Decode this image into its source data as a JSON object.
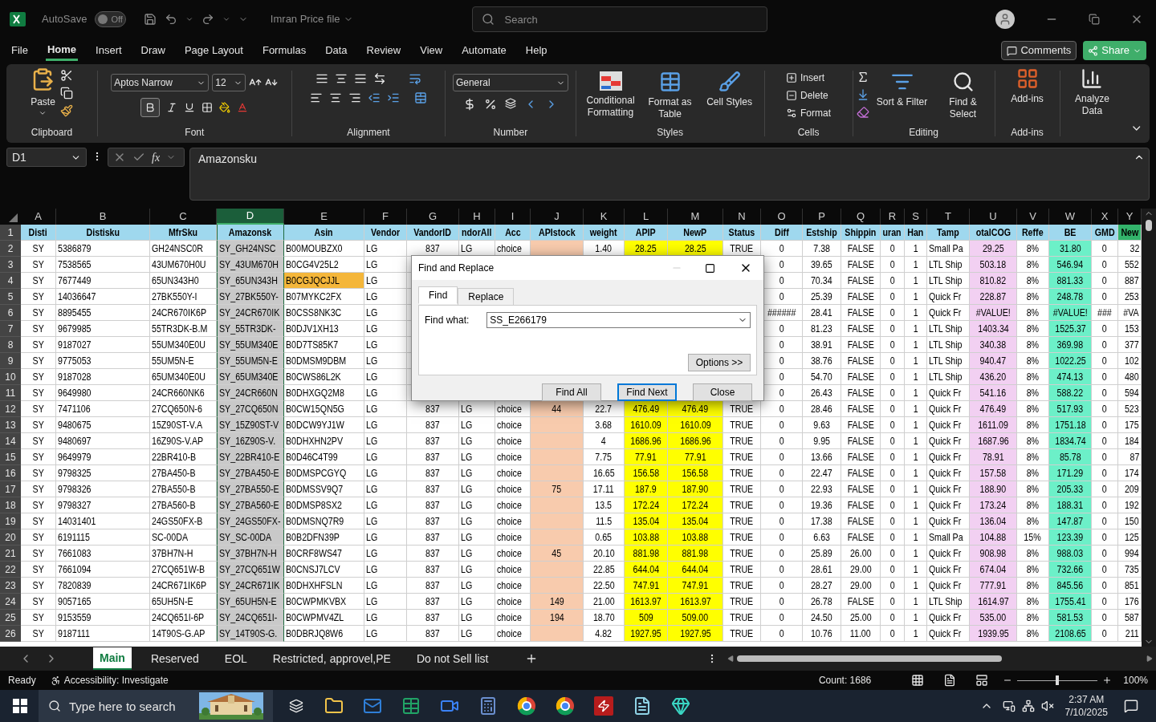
{
  "title_bar": {
    "autosave_label": "AutoSave",
    "autosave": {
      "on": false,
      "label": "Off"
    },
    "file_name": "Imran Price file",
    "search_placeholder": "Search"
  },
  "menu_tabs": [
    {
      "label": "File",
      "selected": false
    },
    {
      "label": "Home",
      "selected": true
    },
    {
      "label": "Insert",
      "selected": false
    },
    {
      "label": "Draw",
      "selected": false
    },
    {
      "label": "Page Layout",
      "selected": false
    },
    {
      "label": "Formulas",
      "selected": false
    },
    {
      "label": "Data",
      "selected": false
    },
    {
      "label": "Review",
      "selected": false
    },
    {
      "label": "View",
      "selected": false
    },
    {
      "label": "Automate",
      "selected": false
    },
    {
      "label": "Help",
      "selected": false
    }
  ],
  "comments_button": "Comments",
  "share_button": "Share",
  "ribbon": {
    "paste": "Paste",
    "font_name": "Aptos Narrow",
    "font_size": "12",
    "bold": true,
    "number_format": "General",
    "style_buttons": [
      "Conditional Formatting",
      "Format as Table",
      "Cell Styles"
    ],
    "cell_buttons": [
      "Insert",
      "Delete",
      "Format"
    ],
    "editing_buttons": [
      "Sort & Filter",
      "Find & Select"
    ],
    "addins_button": "Add-ins",
    "analyze_button": "Analyze Data",
    "groups": [
      "Clipboard",
      "Font",
      "Alignment",
      "Number",
      "Styles",
      "Cells",
      "Editing",
      "Add-ins"
    ]
  },
  "formula_bar": {
    "name_box": "D1",
    "function_label": "fx",
    "content": "Amazonsku"
  },
  "columns": [
    {
      "letter": "A",
      "heading": "Disti",
      "selected": false,
      "heading_fill": false
    },
    {
      "letter": "B",
      "heading": "Distisku",
      "selected": false,
      "heading_fill": false
    },
    {
      "letter": "C",
      "heading": "MfrSku",
      "selected": false,
      "heading_fill": false
    },
    {
      "letter": "D",
      "heading": "Amazonsk",
      "selected": true,
      "heading_fill": false
    },
    {
      "letter": "E",
      "heading": "Asin",
      "selected": false,
      "heading_fill": false
    },
    {
      "letter": "F",
      "heading": "Vendor",
      "selected": false,
      "heading_fill": false
    },
    {
      "letter": "G",
      "heading": "VandorID",
      "selected": false,
      "heading_fill": false
    },
    {
      "letter": "H",
      "heading": "ndorAll",
      "selected": false,
      "heading_fill": false
    },
    {
      "letter": "I",
      "heading": "Acc",
      "selected": false,
      "heading_fill": false
    },
    {
      "letter": "J",
      "heading": "APIstock",
      "selected": false,
      "heading_fill": false,
      "color": "#f8cbad"
    },
    {
      "letter": "K",
      "heading": "weight",
      "selected": false,
      "heading_fill": false
    },
    {
      "letter": "L",
      "heading": "APIP",
      "selected": false,
      "heading_fill": false,
      "color": "#ffff00"
    },
    {
      "letter": "M",
      "heading": "NewP",
      "selected": false,
      "heading_fill": false,
      "color": "#ffff00"
    },
    {
      "letter": "N",
      "heading": "Status",
      "selected": false,
      "heading_fill": false
    },
    {
      "letter": "O",
      "heading": "Diff",
      "selected": false,
      "heading_fill": false
    },
    {
      "letter": "P",
      "heading": "Estship",
      "selected": false,
      "heading_fill": false
    },
    {
      "letter": "Q",
      "heading": "Shippin",
      "selected": false,
      "heading_fill": false
    },
    {
      "letter": "R",
      "heading": "uran",
      "selected": false,
      "heading_fill": false
    },
    {
      "letter": "S",
      "heading": "Han",
      "selected": false,
      "heading_fill": false
    },
    {
      "letter": "T",
      "heading": "Tamp",
      "selected": false,
      "heading_fill": false
    },
    {
      "letter": "U",
      "heading": "otalCOG",
      "selected": false,
      "heading_fill": false,
      "color": "#f2d0f2"
    },
    {
      "letter": "V",
      "heading": "Reffe",
      "selected": false,
      "heading_fill": false
    },
    {
      "letter": "W",
      "heading": "BE",
      "selected": false,
      "heading_fill": false,
      "color": "#6cf0c8"
    },
    {
      "letter": "X",
      "heading": "GMD",
      "selected": false,
      "heading_fill": false
    },
    {
      "letter": "Y",
      "heading": "New",
      "selected": false,
      "heading_fill": true,
      "color": "#33b36b"
    }
  ],
  "rows": [
    {
      "number": "2",
      "flagged": false,
      "cells": [
        "SY",
        "5386879",
        "GH24NSC0R",
        "SY_GH24NSC",
        "B00MOUBZX0",
        "LG",
        "837",
        "LG",
        "choice",
        null,
        "1.40",
        "28.25",
        "28.25",
        "TRUE",
        "0",
        "7.38",
        "FALSE",
        "0",
        "1",
        "Small Pa",
        "29.25",
        "8%",
        "31.80",
        "0",
        "32"
      ]
    },
    {
      "number": "3",
      "flagged": false,
      "cells": [
        "SY",
        "7538565",
        "43UM670H0U",
        "SY_43UM670H",
        "B0CG4V25L2",
        "LG",
        null,
        null,
        null,
        null,
        null,
        null,
        null,
        null,
        "0",
        "39.65",
        "FALSE",
        "0",
        "1",
        "LTL Ship",
        "503.18",
        "8%",
        "546.94",
        "0",
        "552"
      ]
    },
    {
      "number": "4",
      "flagged": true,
      "cells": [
        "SY",
        "7677449",
        "65UN343H0",
        "SY_65UN343H",
        "B0CGJQCJJL",
        "LG",
        null,
        null,
        null,
        null,
        null,
        null,
        null,
        null,
        "0",
        "70.34",
        "FALSE",
        "0",
        "1",
        "LTL Ship",
        "810.82",
        "8%",
        "881.33",
        "0",
        "887"
      ]
    },
    {
      "number": "5",
      "flagged": false,
      "cells": [
        "SY",
        "14036647",
        "27BK550Y-I",
        "SY_27BK550Y-",
        "B07MYKC2FX",
        "LG",
        null,
        null,
        null,
        null,
        null,
        null,
        null,
        null,
        "0",
        "25.39",
        "FALSE",
        "0",
        "1",
        "Quick Fr",
        "228.87",
        "8%",
        "248.78",
        "0",
        "253"
      ]
    },
    {
      "number": "6",
      "flagged": false,
      "cells": [
        "SY",
        "8895455",
        "24CR670IK6P",
        "SY_24CR670IK",
        "B0CSS8NK3C",
        "LG",
        null,
        null,
        null,
        null,
        null,
        null,
        null,
        null,
        "######",
        "28.41",
        "FALSE",
        "0",
        "1",
        "Quick Fr",
        "#VALUE!",
        "8%",
        "#VALUE!",
        "###",
        "#VA"
      ]
    },
    {
      "number": "7",
      "flagged": false,
      "cells": [
        "SY",
        "9679985",
        "55TR3DK-B.M",
        "SY_55TR3DK-",
        "B0DJV1XH13",
        "LG",
        null,
        null,
        null,
        null,
        null,
        null,
        null,
        null,
        "0",
        "81.23",
        "FALSE",
        "0",
        "1",
        "LTL Ship",
        "1403.34",
        "8%",
        "1525.37",
        "0",
        "153"
      ]
    },
    {
      "number": "8",
      "flagged": false,
      "cells": [
        "SY",
        "9187027",
        "55UM340E0U",
        "SY_55UM340E",
        "B0D7TS85K7",
        "LG",
        null,
        null,
        null,
        null,
        null,
        null,
        null,
        null,
        "0",
        "38.91",
        "FALSE",
        "0",
        "1",
        "LTL Ship",
        "340.38",
        "8%",
        "369.98",
        "0",
        "377"
      ]
    },
    {
      "number": "9",
      "flagged": false,
      "cells": [
        "SY",
        "9775053",
        "55UM5N-E",
        "SY_55UM5N-E",
        "B0DMSM9DBM",
        "LG",
        null,
        null,
        null,
        null,
        null,
        null,
        null,
        null,
        "0",
        "38.76",
        "FALSE",
        "0",
        "1",
        "LTL Ship",
        "940.47",
        "8%",
        "1022.25",
        "0",
        "102"
      ]
    },
    {
      "number": "10",
      "flagged": false,
      "cells": [
        "SY",
        "9187028",
        "65UM340E0U",
        "SY_65UM340E",
        "B0CWS86L2K",
        "LG",
        null,
        null,
        null,
        null,
        null,
        null,
        null,
        null,
        "0",
        "54.70",
        "FALSE",
        "0",
        "1",
        "LTL Ship",
        "436.20",
        "8%",
        "474.13",
        "0",
        "480"
      ]
    },
    {
      "number": "11",
      "flagged": false,
      "cells": [
        "SY",
        "9649980",
        "24CR660NK6",
        "SY_24CR660N",
        "B0DHXGQ2M8",
        "LG",
        null,
        null,
        null,
        null,
        null,
        null,
        null,
        null,
        "0",
        "26.43",
        "FALSE",
        "0",
        "1",
        "Quick Fr",
        "541.16",
        "8%",
        "588.22",
        "0",
        "594"
      ]
    },
    {
      "number": "12",
      "flagged": false,
      "cells": [
        "SY",
        "7471106",
        "27CQ650N-6",
        "SY_27CQ650N",
        "B0CW15QN5G",
        "LG",
        "837",
        "LG",
        "choice",
        "44",
        "22.7",
        "476.49",
        "476.49",
        "TRUE",
        "0",
        "28.46",
        "FALSE",
        "0",
        "1",
        "Quick Fr",
        "476.49",
        "8%",
        "517.93",
        "0",
        "523"
      ]
    },
    {
      "number": "13",
      "flagged": false,
      "cells": [
        "SY",
        "9480675",
        "15Z90ST-V.A",
        "SY_15Z90ST-V",
        "B0DCW9YJ1W",
        "LG",
        "837",
        "LG",
        "choice",
        null,
        "3.68",
        "1610.09",
        "1610.09",
        "TRUE",
        "0",
        "9.63",
        "FALSE",
        "0",
        "1",
        "Quick Fr",
        "1611.09",
        "8%",
        "1751.18",
        "0",
        "175"
      ]
    },
    {
      "number": "14",
      "flagged": false,
      "cells": [
        "SY",
        "9480697",
        "16Z90S-V.AP",
        "SY_16Z90S-V.",
        "B0DHXHN2PV",
        "LG",
        "837",
        "LG",
        "choice",
        null,
        "4",
        "1686.96",
        "1686.96",
        "TRUE",
        "0",
        "9.95",
        "FALSE",
        "0",
        "1",
        "Quick Fr",
        "1687.96",
        "8%",
        "1834.74",
        "0",
        "184"
      ]
    },
    {
      "number": "15",
      "flagged": false,
      "cells": [
        "SY",
        "9649979",
        "22BR410-B",
        "SY_22BR410-E",
        "B0D46C4T99",
        "LG",
        "837",
        "LG",
        "choice",
        null,
        "7.75",
        "77.91",
        "77.91",
        "TRUE",
        "0",
        "13.66",
        "FALSE",
        "0",
        "1",
        "Quick Fr",
        "78.91",
        "8%",
        "85.78",
        "0",
        "87"
      ]
    },
    {
      "number": "16",
      "flagged": false,
      "cells": [
        "SY",
        "9798325",
        "27BA450-B",
        "SY_27BA450-E",
        "B0DMSPCGYQ",
        "LG",
        "837",
        "LG",
        "choice",
        null,
        "16.65",
        "156.58",
        "156.58",
        "TRUE",
        "0",
        "22.47",
        "FALSE",
        "0",
        "1",
        "Quick Fr",
        "157.58",
        "8%",
        "171.29",
        "0",
        "174"
      ]
    },
    {
      "number": "17",
      "flagged": false,
      "cells": [
        "SY",
        "9798326",
        "27BA550-B",
        "SY_27BA550-E",
        "B0DMSSV9Q7",
        "LG",
        "837",
        "LG",
        "choice",
        "75",
        "17.11",
        "187.9",
        "187.90",
        "TRUE",
        "0",
        "22.93",
        "FALSE",
        "0",
        "1",
        "Quick Fr",
        "188.90",
        "8%",
        "205.33",
        "0",
        "209"
      ]
    },
    {
      "number": "18",
      "flagged": false,
      "cells": [
        "SY",
        "9798327",
        "27BA560-B",
        "SY_27BA560-E",
        "B0DMSP8SX2",
        "LG",
        "837",
        "LG",
        "choice",
        null,
        "13.5",
        "172.24",
        "172.24",
        "TRUE",
        "0",
        "19.36",
        "FALSE",
        "0",
        "1",
        "Quick Fr",
        "173.24",
        "8%",
        "188.31",
        "0",
        "192"
      ]
    },
    {
      "number": "19",
      "flagged": false,
      "cells": [
        "SY",
        "14031401",
        "24GS50FX-B",
        "SY_24GS50FX-",
        "B0DMSNQ7R9",
        "LG",
        "837",
        "LG",
        "choice",
        null,
        "11.5",
        "135.04",
        "135.04",
        "TRUE",
        "0",
        "17.38",
        "FALSE",
        "0",
        "1",
        "Quick Fr",
        "136.04",
        "8%",
        "147.87",
        "0",
        "150"
      ]
    },
    {
      "number": "20",
      "flagged": false,
      "cells": [
        "SY",
        "6191115",
        "SC-00DA",
        "SY_SC-00DA",
        "B0B2DFN39P",
        "LG",
        "837",
        "LG",
        "choice",
        null,
        "0.65",
        "103.88",
        "103.88",
        "TRUE",
        "0",
        "6.63",
        "FALSE",
        "0",
        "1",
        "Small Pa",
        "104.88",
        "15%",
        "123.39",
        "0",
        "125"
      ]
    },
    {
      "number": "21",
      "flagged": false,
      "cells": [
        "SY",
        "7661083",
        "37BH7N-H",
        "SY_37BH7N-H",
        "B0CRF8WS47",
        "LG",
        "837",
        "LG",
        "choice",
        "45",
        "20.10",
        "881.98",
        "881.98",
        "TRUE",
        "0",
        "25.89",
        "26.00",
        "0",
        "1",
        "Quick Fr",
        "908.98",
        "8%",
        "988.03",
        "0",
        "994"
      ]
    },
    {
      "number": "22",
      "flagged": false,
      "cells": [
        "SY",
        "7661094",
        "27CQ651W-B",
        "SY_27CQ651W",
        "B0CNSJ7LCV",
        "LG",
        "837",
        "LG",
        "choice",
        null,
        "22.85",
        "644.04",
        "644.04",
        "TRUE",
        "0",
        "28.61",
        "29.00",
        "0",
        "1",
        "Quick Fr",
        "674.04",
        "8%",
        "732.66",
        "0",
        "735"
      ]
    },
    {
      "number": "23",
      "flagged": false,
      "cells": [
        "SY",
        "7820839",
        "24CR671IK6P",
        "SY_24CR671IK",
        "B0DHXHFSLN",
        "LG",
        "837",
        "LG",
        "choice",
        null,
        "22.50",
        "747.91",
        "747.91",
        "TRUE",
        "0",
        "28.27",
        "29.00",
        "0",
        "1",
        "Quick Fr",
        "777.91",
        "8%",
        "845.56",
        "0",
        "851"
      ]
    },
    {
      "number": "24",
      "flagged": false,
      "cells": [
        "SY",
        "9057165",
        "65UH5N-E",
        "SY_65UH5N-E",
        "B0CWPMKVBX",
        "LG",
        "837",
        "LG",
        "choice",
        "149",
        "21.00",
        "1613.97",
        "1613.97",
        "TRUE",
        "0",
        "26.78",
        "FALSE",
        "0",
        "1",
        "LTL Ship",
        "1614.97",
        "8%",
        "1755.41",
        "0",
        "176"
      ]
    },
    {
      "number": "25",
      "flagged": false,
      "cells": [
        "SY",
        "9153559",
        "24CQ651I-6P",
        "SY_24CQ651I-",
        "B0CWPMV4ZL",
        "LG",
        "837",
        "LG",
        "choice",
        "194",
        "18.70",
        "509",
        "509.00",
        "TRUE",
        "0",
        "24.50",
        "25.00",
        "0",
        "1",
        "Quick Fr",
        "535.00",
        "8%",
        "581.53",
        "0",
        "587"
      ]
    },
    {
      "number": "26",
      "flagged": false,
      "cells": [
        "SY",
        "9187111",
        "14T90S-G.AP",
        "SY_14T90S-G.",
        "B0DBRJQ8W6",
        "LG",
        "837",
        "LG",
        "choice",
        null,
        "4.82",
        "1927.95",
        "1927.95",
        "TRUE",
        "0",
        "10.76",
        "11.00",
        "0",
        "1",
        "Quick Fr",
        "1939.95",
        "8%",
        "2108.65",
        "0",
        "211"
      ]
    }
  ],
  "header_row_number": "1",
  "dialog": {
    "title": "Find and Replace",
    "tabs": [
      {
        "label": "Find",
        "selected": true
      },
      {
        "label": "Replace",
        "selected": false
      }
    ],
    "find_label": "Find what:",
    "find_value": "SS_E266179",
    "options_button": "Options >>",
    "buttons": [
      {
        "label": "Find All",
        "default": false
      },
      {
        "label": "Find Next",
        "default": true
      },
      {
        "label": "Close",
        "default": false
      }
    ]
  },
  "sheet_tabs": [
    {
      "label": "Main",
      "selected": true
    },
    {
      "label": "Reserved",
      "selected": false
    },
    {
      "label": "EOL",
      "selected": false
    },
    {
      "label": "Restricted, approvel,PE",
      "selected": false
    },
    {
      "label": "Do not Sell list",
      "selected": false
    }
  ],
  "status_bar": {
    "mode": "Ready",
    "accessibility": "Accessibility: Investigate",
    "count": "Count: 1686",
    "zoom": {
      "level": 0.5,
      "label": "100%"
    }
  },
  "taskbar": {
    "search_placeholder": "Type here to search",
    "time": "2:37 AM",
    "date": "7/10/2025"
  }
}
